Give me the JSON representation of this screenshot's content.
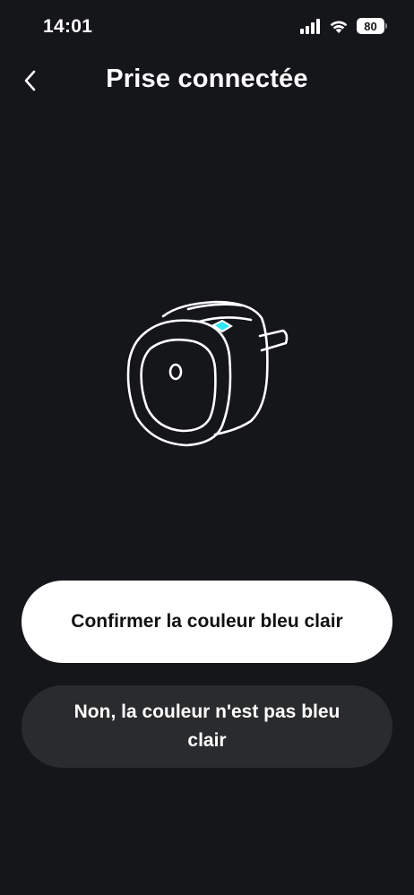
{
  "status_bar": {
    "time": "14:01",
    "battery_level": "80",
    "icons": [
      "signal-icon",
      "wifi-icon",
      "battery-icon"
    ]
  },
  "header": {
    "title": "Prise connectée",
    "back_icon": "chevron-left-icon"
  },
  "illustration": {
    "name": "smart-plug-illustration",
    "led_color": "#2ee6f0"
  },
  "actions": {
    "confirm_label": "Confirmer la couleur bleu clair",
    "deny_label": "Non, la couleur n'est pas bleu clair"
  },
  "colors": {
    "background": "#151619",
    "primary_button": "#ffffff",
    "secondary_button": "#2a2b2d"
  }
}
